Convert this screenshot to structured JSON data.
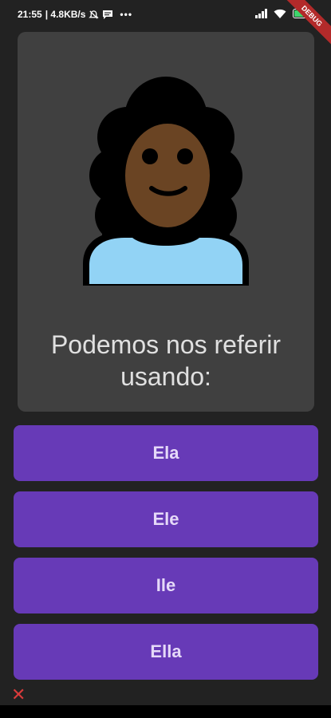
{
  "status_bar": {
    "time": "21:55",
    "network_speed": "| 4.8KB/s",
    "icons": [
      "mute-icon",
      "message-icon",
      "more-icon",
      "signal-icon",
      "wifi-icon",
      "battery-icon"
    ],
    "battery_level": 0.7
  },
  "debug_banner": "DEBUG",
  "card": {
    "avatar_icon": "woman-curly-hair-emoji",
    "question": "Podemos nos referir usando:"
  },
  "options": [
    {
      "label": "Ela"
    },
    {
      "label": "Ele"
    },
    {
      "label": "Ile"
    },
    {
      "label": "Ella"
    }
  ],
  "footer": {
    "wrong_mark": "✕"
  },
  "colors": {
    "background": "#222222",
    "card": "#404040",
    "button": "#673ab7",
    "button_text": "#e5d9f8",
    "error": "#d93b3b"
  }
}
